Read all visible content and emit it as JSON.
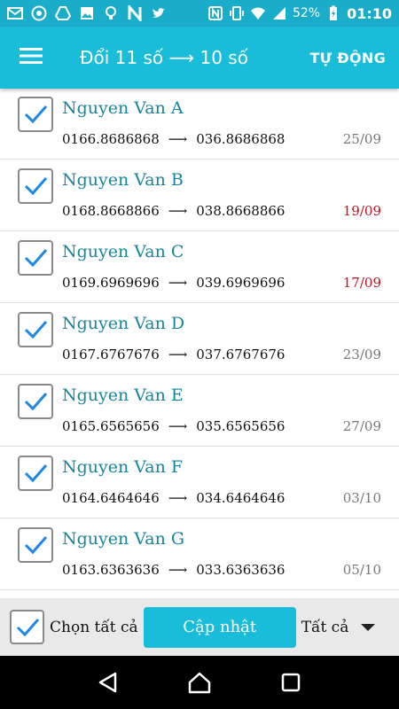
{
  "status_bar": {
    "battery_percent": "52%",
    "time": "01:10",
    "left_icons": [
      "gmail-icon",
      "chrome-icon",
      "drive-icon",
      "image-icon",
      "bulb-icon",
      "n-icon",
      "twitter-icon"
    ],
    "right_icons": [
      "nfc-icon",
      "vibrate-icon",
      "wifi-icon",
      "signal-icon",
      "battery-charging-icon"
    ]
  },
  "app_bar": {
    "title": "Đổi 11 số ⟶ 10 số",
    "action_label": "TỰ ĐỘNG",
    "menu_icon": "menu-icon"
  },
  "contacts": [
    {
      "name": "Nguyen Van A",
      "old": "0166.8686868",
      "new": "036.8686868",
      "date": "25/09",
      "date_color": "#777777",
      "checked": true
    },
    {
      "name": "Nguyen Van B",
      "old": "0168.8668866",
      "new": "038.8668866",
      "date": "19/09",
      "date_color": "#c0141e",
      "checked": true
    },
    {
      "name": "Nguyen Van C",
      "old": "0169.6969696",
      "new": "039.6969696",
      "date": "17/09",
      "date_color": "#c0141e",
      "checked": true
    },
    {
      "name": "Nguyen Van D",
      "old": "0167.6767676",
      "new": "037.6767676",
      "date": "23/09",
      "date_color": "#777777",
      "checked": true
    },
    {
      "name": "Nguyen Van E",
      "old": "0165.6565656",
      "new": "035.6565656",
      "date": "27/09",
      "date_color": "#777777",
      "checked": true
    },
    {
      "name": "Nguyen Van F",
      "old": "0164.6464646",
      "new": "034.6464646",
      "date": "03/10",
      "date_color": "#777777",
      "checked": true
    },
    {
      "name": "Nguyen Van G",
      "old": "0163.6363636",
      "new": "033.6363636",
      "date": "05/10",
      "date_color": "#777777",
      "checked": true
    }
  ],
  "arrow_glyph": "⟶",
  "action_bar": {
    "select_all_label": "Chọn tất cả",
    "select_all_checked": true,
    "update_label": "Cập nhật",
    "filter_value": "Tất cả"
  },
  "colors": {
    "accent": "#19bcd9",
    "check": "#1e88e5",
    "name": "#16869a",
    "warning_date": "#c0141e"
  },
  "nav_bar": {
    "buttons": [
      "back-icon",
      "home-icon",
      "recents-icon"
    ]
  }
}
